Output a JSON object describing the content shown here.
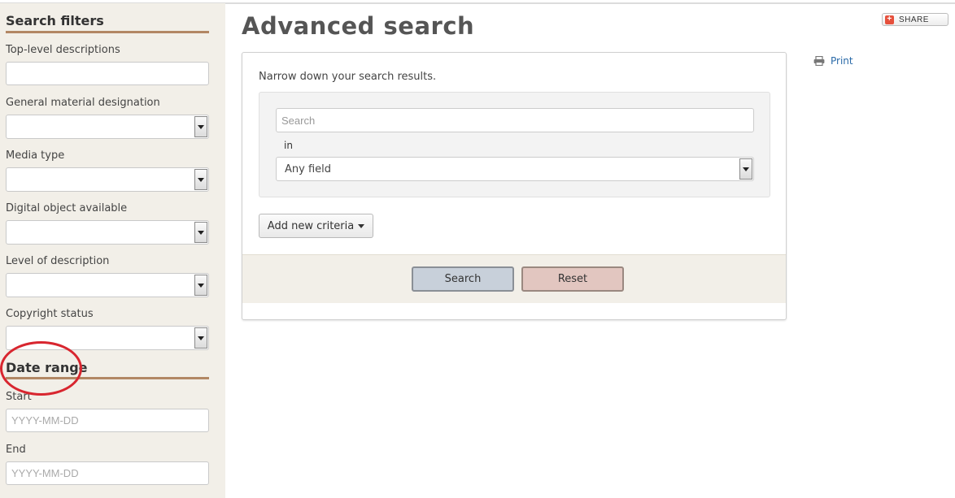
{
  "sidebar": {
    "filters_heading": "Search filters",
    "fields": [
      {
        "label": "Top-level descriptions",
        "type": "input",
        "value": ""
      },
      {
        "label": "General material designation",
        "type": "select",
        "value": ""
      },
      {
        "label": "Media type",
        "type": "select",
        "value": ""
      },
      {
        "label": "Digital object available",
        "type": "select",
        "value": ""
      },
      {
        "label": "Level of description",
        "type": "select",
        "value": ""
      },
      {
        "label": "Copyright status",
        "type": "select",
        "value": ""
      }
    ],
    "date_heading": "Date range",
    "start_label": "Start",
    "start_placeholder": "YYYY-MM-DD",
    "end_label": "End",
    "end_placeholder": "YYYY-MM-DD"
  },
  "main": {
    "title": "Advanced search",
    "intro": "Narrow down your search results.",
    "search_placeholder": "Search",
    "in_label": "in",
    "field_selected": "Any field",
    "add_criteria_label": "Add new criteria",
    "search_button": "Search",
    "reset_button": "Reset"
  },
  "actions": {
    "print_label": "Print",
    "share_label": "SHARE"
  },
  "annotation": {
    "color": "#d8262f",
    "target": "Date range"
  },
  "colors": {
    "sidebar_bg": "#f2efe8",
    "heading_rule": "#b28764",
    "link": "#2a6aa8",
    "search_button": "#c8d0da",
    "reset_button": "#e2c6c0"
  }
}
